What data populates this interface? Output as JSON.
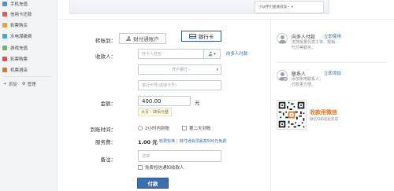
{
  "sidebar": {
    "items": [
      {
        "label": "手机充值",
        "color": "#4a8fd8"
      },
      {
        "label": "信用卡还款",
        "color": "#e0595a"
      },
      {
        "label": "彩票购买",
        "color": "#e8a23a"
      },
      {
        "label": "水电煤缴费",
        "color": "#3fa7d9"
      },
      {
        "label": "游戏充值",
        "color": "#6db46b"
      },
      {
        "label": "彩票购票",
        "color": "#d9534f"
      },
      {
        "label": "机票酒店",
        "color": "#c87d3a"
      }
    ],
    "add_label": "添加",
    "manage_label": "管理"
  },
  "top": {
    "search_text": "小伙伴们速速说谈~"
  },
  "form": {
    "transfer_to_label": "转账到：",
    "tab_account_label": "财付通账户",
    "tab_card_label": "银行卡",
    "payee_label": "收款人：",
    "payee_placeholder": "持卡人姓名",
    "payee_link": "向多人付款",
    "bank_select_placeholder": "- 开户银行 -",
    "card_placeholder": "银行卡号(选填卡号)",
    "amount_label": "金额：",
    "amount_value": "400.00",
    "amount_unit": "元",
    "amount_caps": "大写：肆佰元整",
    "arrival_label": "到账时间：",
    "arrival_opt1": "2小时内到账",
    "arrival_opt2": "第二天到账",
    "fee_label": "服务费：",
    "fee_value": "1.00 元",
    "fee_link1": "收费标准",
    "fee_link2": "财付通会员最高500元免费",
    "note_label": "备注：",
    "note_placeholder": "选填",
    "sms_label": "免费短信通知收款人",
    "pay_button": "付款"
  },
  "right": {
    "multi_title": "向多人付款",
    "multi_link": "立即使用",
    "multi_desc1": "支持批量代发工资、报销、",
    "multi_desc2": "代付等服务。",
    "contacts_title": "联系人",
    "contacts_link": "立即添加",
    "contacts_desc1": "添加常用联系人，",
    "contacts_desc2": "付款更方便。",
    "qr_title": "收款用微信",
    "qr_desc1": "微信扫码轻松完成",
    "qr_desc2": "",
    "accent_color": "#e8761f"
  }
}
